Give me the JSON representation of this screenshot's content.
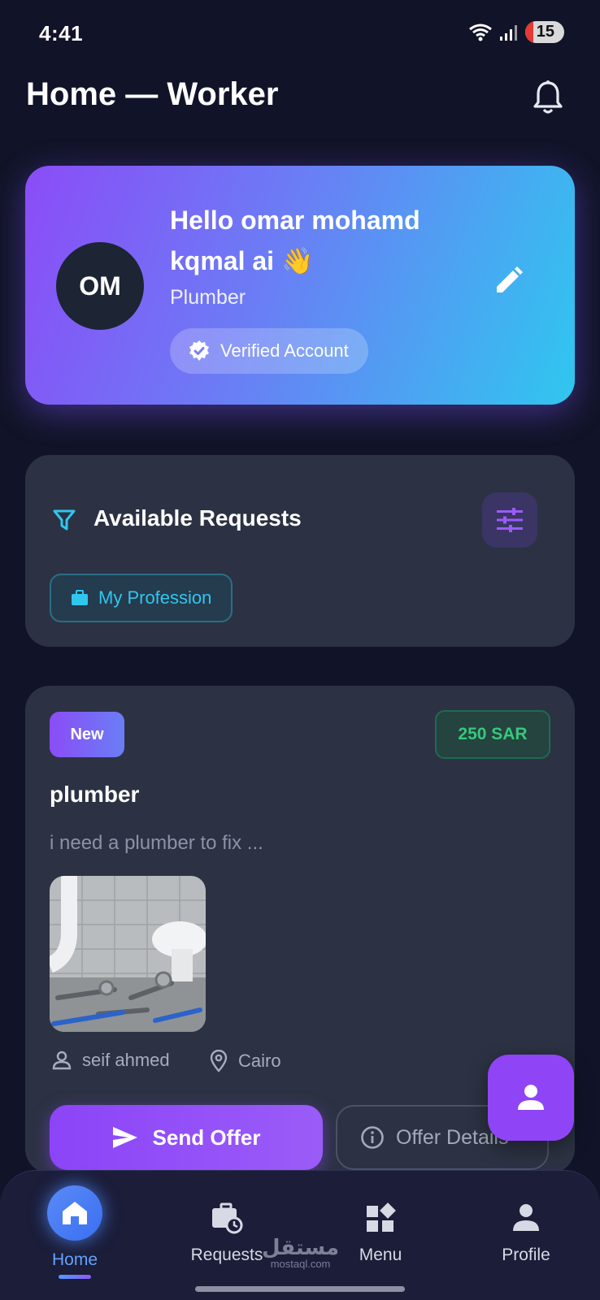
{
  "status_bar": {
    "time": "4:41",
    "battery": "15"
  },
  "header": {
    "title": "Home — Worker"
  },
  "profile": {
    "initials": "OM",
    "greeting": "Hello omar mohamd kqmal ai 👋",
    "profession": "Plumber",
    "verified_label": "Verified Account"
  },
  "requests_section": {
    "title": "Available Requests",
    "filter_chip": "My Profession"
  },
  "job": {
    "badge": "New",
    "price": "250 SAR",
    "title": "plumber",
    "description": "i need a plumber to fix ...",
    "client": "seif ahmed",
    "location": "Cairo",
    "send_offer": "Send Offer",
    "offer_details": "Offer Details"
  },
  "bottom_nav": {
    "items": [
      {
        "label": "Home",
        "icon": "home-icon"
      },
      {
        "label": "Requests",
        "icon": "briefcase-clock-icon"
      },
      {
        "label": "Menu",
        "icon": "widgets-icon"
      },
      {
        "label": "Profile",
        "icon": "person-icon"
      }
    ]
  },
  "watermark": {
    "arabic": "مستقل",
    "latin": "mostaql.com"
  },
  "colors": {
    "background": "#111428",
    "accent_purple": "#8c44f7",
    "accent_cyan": "#31c6ee",
    "price_green": "#35c97c",
    "card": "#2c3243"
  }
}
